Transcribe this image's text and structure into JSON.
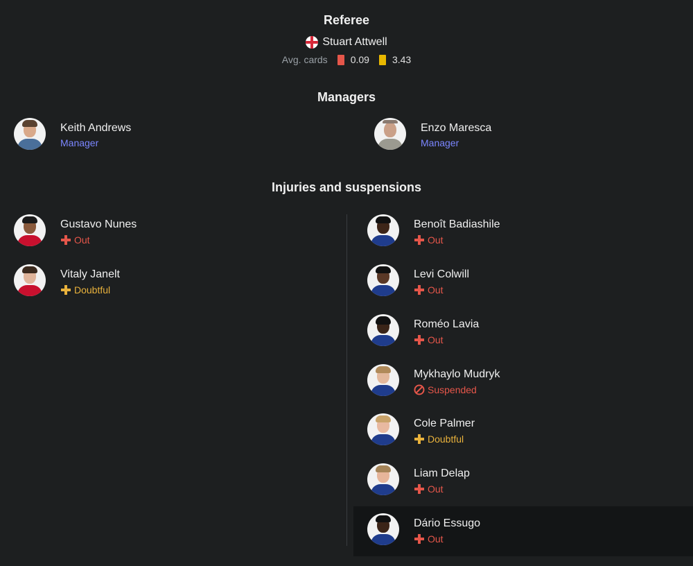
{
  "referee": {
    "title": "Referee",
    "name": "Stuart Attwell",
    "flag_icon": "england-flag-icon",
    "avg_cards_label": "Avg. cards",
    "red_avg": "0.09",
    "yellow_avg": "3.43"
  },
  "managers": {
    "title": "Managers",
    "home": {
      "name": "Keith Andrews",
      "role": "Manager"
    },
    "away": {
      "name": "Enzo Maresca",
      "role": "Manager"
    }
  },
  "injuries": {
    "title": "Injuries and suspensions",
    "home": [
      {
        "name": "Gustavo Nunes",
        "status": "Out"
      },
      {
        "name": "Vitaly Janelt",
        "status": "Doubtful"
      }
    ],
    "away": [
      {
        "name": "Benoît Badiashile",
        "status": "Out"
      },
      {
        "name": "Levi Colwill",
        "status": "Out"
      },
      {
        "name": "Roméo Lavia",
        "status": "Out"
      },
      {
        "name": "Mykhaylo Mudryk",
        "status": "Suspended"
      },
      {
        "name": "Cole Palmer",
        "status": "Doubtful"
      },
      {
        "name": "Liam Delap",
        "status": "Out"
      },
      {
        "name": "Dário Essugo",
        "status": "Out"
      }
    ]
  },
  "colors": {
    "background": "#1d1f20",
    "out": "#e5564a",
    "doubtful": "#e9b23c",
    "manager_role": "#7b86ff",
    "red_card": "#e5564a",
    "yellow_card": "#e9b800"
  }
}
